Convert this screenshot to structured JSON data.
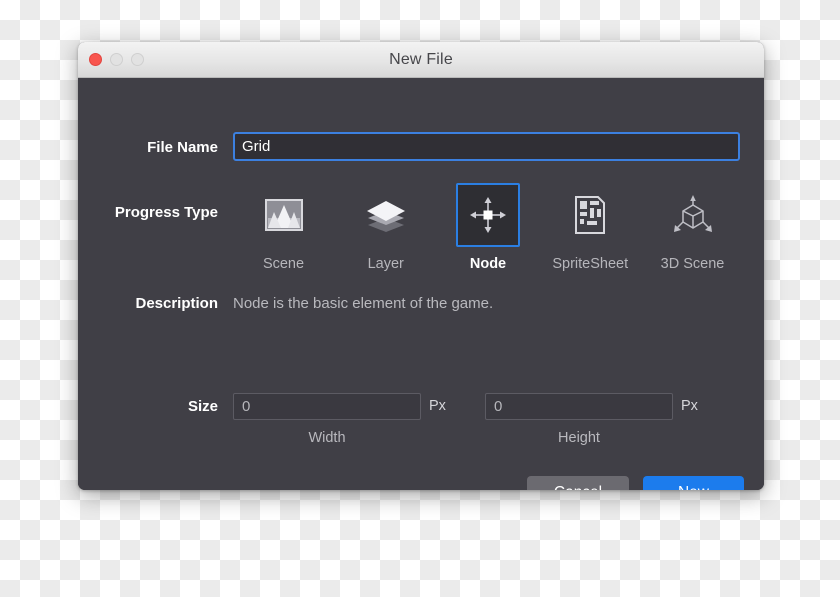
{
  "window": {
    "title": "New File",
    "traffic_lights": [
      "close",
      "minimize",
      "maximize"
    ],
    "accent_color": "#1c7ced",
    "body_color": "#403f46"
  },
  "form": {
    "file_name": {
      "label": "File Name",
      "value": "Grid",
      "placeholder": "",
      "focused": true
    },
    "progress_type": {
      "label": "Progress Type",
      "selected": "Node",
      "options": [
        {
          "label": "Scene",
          "icon": "scene-icon"
        },
        {
          "label": "Layer",
          "icon": "layer-icon"
        },
        {
          "label": "Node",
          "icon": "node-icon"
        },
        {
          "label": "SpriteSheet",
          "icon": "spritesheet-icon"
        },
        {
          "label": "3D Scene",
          "icon": "cube-3d-icon"
        }
      ]
    },
    "description": {
      "label": "Description",
      "text": "Node is the basic element of the game."
    },
    "size": {
      "label": "Size",
      "width": {
        "value": "0",
        "unit": "Px",
        "caption": "Width"
      },
      "height": {
        "value": "0",
        "unit": "Px",
        "caption": "Height"
      }
    }
  },
  "footer": {
    "cancel_label": "Cancel",
    "confirm_label": "New"
  }
}
